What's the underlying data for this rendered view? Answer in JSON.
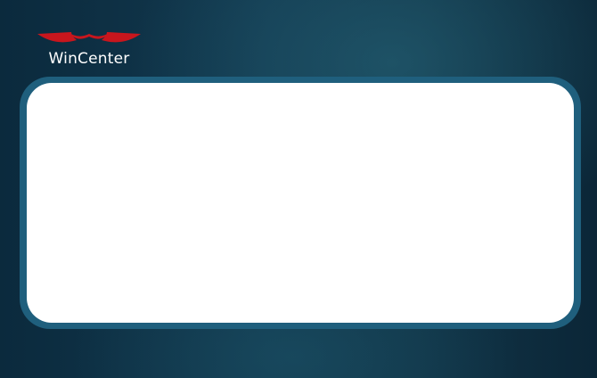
{
  "brand": {
    "name": "WinCenter",
    "logo_icon": "wincenter-logo-icon",
    "accent_color": "#c8161d"
  },
  "panel": {
    "border_color": "#1f5f7d",
    "fill_color": "#ffffff"
  }
}
